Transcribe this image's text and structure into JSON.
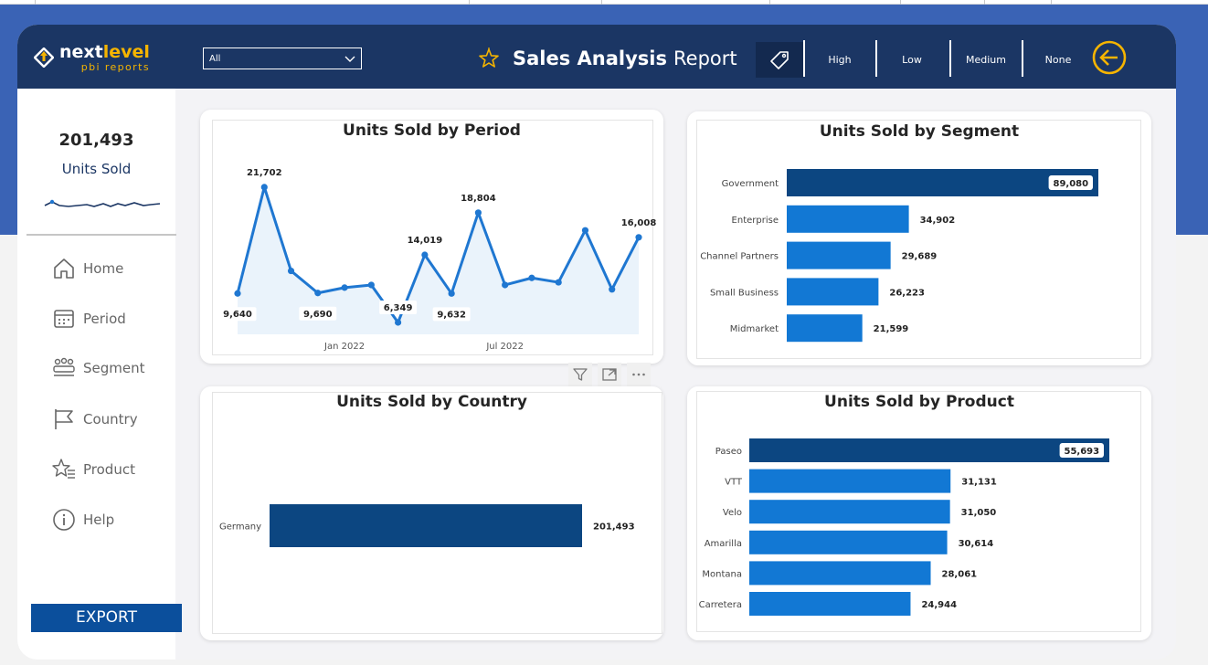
{
  "header": {
    "logo": {
      "brand_main": "next",
      "brand_accent": "level",
      "brand_sub": "pbi reports"
    },
    "filter": {
      "selected": "All"
    },
    "title_bold": "Sales Analysis",
    "title_regular": "Report",
    "segments": [
      "High",
      "Low",
      "Medium",
      "None"
    ],
    "icons": [
      "tag-icon",
      "star-icon",
      "back-arrow-icon",
      "chevron-down-icon"
    ],
    "colors": {
      "header_bg": "#1b3664",
      "accent": "#f5b400"
    }
  },
  "sidebar": {
    "kpi_value": "201,493",
    "kpi_label": "Units Sold",
    "nav": [
      {
        "label": "Home",
        "icon": "home-icon"
      },
      {
        "label": "Period",
        "icon": "calendar-icon"
      },
      {
        "label": "Segment",
        "icon": "people-icon"
      },
      {
        "label": "Country",
        "icon": "flag-icon"
      },
      {
        "label": "Product",
        "icon": "star-list-icon"
      },
      {
        "label": "Help",
        "icon": "info-icon"
      }
    ],
    "export_label": "EXPORT"
  },
  "chart_data": [
    {
      "type": "line",
      "title": "Units Sold by Period",
      "x_tick_labels": [
        "Jan 2022",
        "Jul 2022"
      ],
      "x": [
        "2021-09",
        "2021-10",
        "2021-11",
        "2021-12",
        "2022-01",
        "2022-02",
        "2022-03",
        "2022-04",
        "2022-05",
        "2022-06",
        "2022-07",
        "2022-08",
        "2022-09",
        "2022-10",
        "2022-11",
        "2022-12"
      ],
      "values": [
        9640,
        21702,
        12200,
        9690,
        10300,
        10600,
        6349,
        14019,
        9632,
        18804,
        10600,
        11400,
        10900,
        16800,
        10100,
        16008
      ],
      "data_labels": {
        "0": "9,640",
        "1": "21,702",
        "3": "9,690",
        "6": "6,349",
        "7": "14,019",
        "8": "9,632",
        "9": "18,804",
        "15": "16,008"
      },
      "color": "#1f77d1",
      "fill": "#eaf3fb"
    },
    {
      "type": "bar",
      "title": "Units Sold by Segment",
      "categories": [
        "Government",
        "Enterprise",
        "Channel Partners",
        "Small Business",
        "Midmarket"
      ],
      "values": [
        89080,
        34902,
        29689,
        26223,
        21599
      ],
      "value_labels": [
        "89,080",
        "34,902",
        "29,689",
        "26,223",
        "21,599"
      ],
      "highlight_color": "#0c4681",
      "color": "#1278d4"
    },
    {
      "type": "bar",
      "title": "Units Sold by Country",
      "categories": [
        "Germany"
      ],
      "values": [
        201493
      ],
      "value_labels": [
        "201,493"
      ],
      "color": "#0c4681"
    },
    {
      "type": "bar",
      "title": "Units Sold by Product",
      "categories": [
        "Paseo",
        "VTT",
        "Velo",
        "Amarilla",
        "Montana",
        "Carretera"
      ],
      "values": [
        55693,
        31131,
        31050,
        30614,
        28061,
        24944
      ],
      "value_labels": [
        "55,693",
        "31,131",
        "31,050",
        "30,614",
        "28,061",
        "24,944"
      ],
      "highlight_color": "#0c4681",
      "color": "#1278d4"
    }
  ]
}
